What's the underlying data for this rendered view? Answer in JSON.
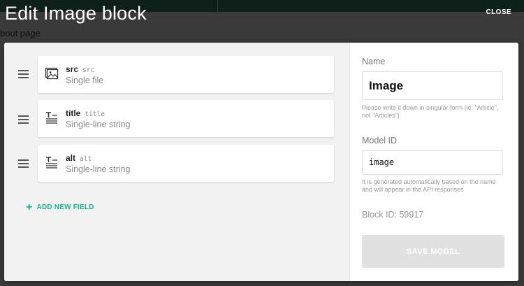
{
  "dialog": {
    "title": "Edit Image block",
    "close_label": "CLOSE"
  },
  "background": {
    "page_text": "bout page"
  },
  "fields": [
    {
      "name": "src",
      "api_key": "src",
      "type": "Single file",
      "icon": "image-file-icon"
    },
    {
      "name": "title",
      "api_key": "title",
      "type": "Single-line string",
      "icon": "text-field-icon"
    },
    {
      "name": "alt",
      "api_key": "alt",
      "type": "Single-line string",
      "icon": "text-field-icon"
    }
  ],
  "add_field_label": "ADD NEW FIELD",
  "form": {
    "name_label": "Name",
    "name_value": "Image",
    "name_hint": "Please write it down in singular form (ie. \"Article\", not \"Articles\")",
    "model_id_label": "Model ID",
    "model_id_value": "image",
    "model_id_hint": "It is generated automatically based on the name and will appear in the API responses",
    "block_id": "Block ID: 59917",
    "save_label": "SAVE MODEL"
  },
  "colors": {
    "accent": "#15b58f",
    "save_disabled": "#e1e1e1"
  }
}
